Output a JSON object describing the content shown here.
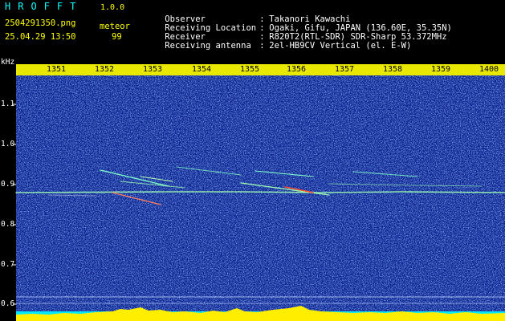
{
  "header": {
    "app_title": "HROFFT",
    "app_version": "1.0.0",
    "file_name": "2504291350.png",
    "date_time": "25.04.29 13:50",
    "meteor_label": "meteor",
    "meteor_count": "99"
  },
  "info": [
    {
      "label": "Observer",
      "sep": ":",
      "value": "Takanori Kawachi"
    },
    {
      "label": "Receiving Location",
      "sep": ":",
      "value": "Ogaki, Gifu, JAPAN (136.60E, 35.35N)"
    },
    {
      "label": "Receiver",
      "sep": ":",
      "value": "R820T2(RTL-SDR) SDR-Sharp 53.372MHz"
    },
    {
      "label": "Receiving antenna",
      "sep": ":",
      "value": "2el-HB9CV Vertical (el. E-W)"
    }
  ],
  "spectrogram": {
    "frequency_unit": "kHz",
    "y_ticks": [
      "1.1",
      "1.0",
      "0.9",
      "0.8",
      "0.7",
      "0.6"
    ],
    "x_ticks": [
      "1351",
      "1352",
      "1353",
      "1354",
      "1355",
      "1356",
      "1357",
      "1358",
      "1359",
      "1400"
    ],
    "colors": {
      "background": "#0a1e8c",
      "noise": "#2f6aff",
      "ruler": "#e8e800",
      "baseline": "#00e8ff",
      "activity": "#ffee00",
      "carrier": "#9dffb0",
      "echo_hot": "#ff5030"
    }
  }
}
